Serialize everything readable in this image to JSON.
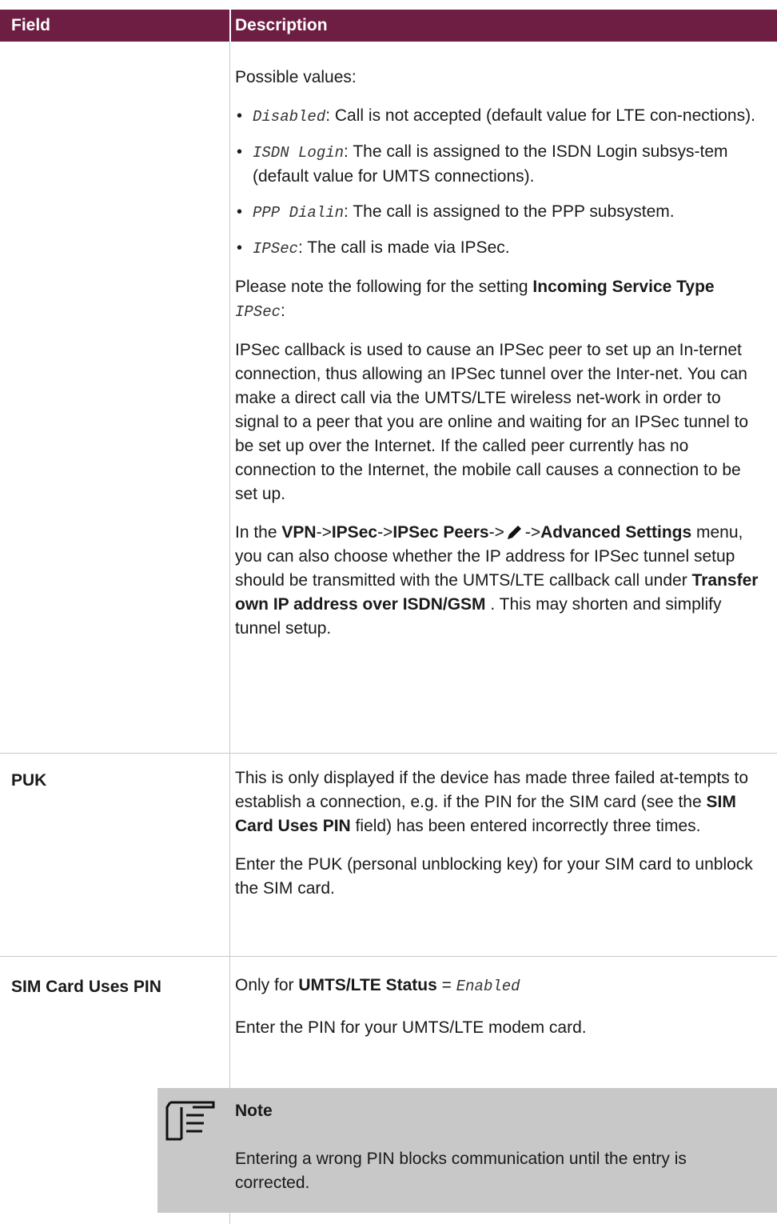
{
  "header": {
    "field": "Field",
    "description": "Description"
  },
  "row1": {
    "possible_values": "Possible values:",
    "items": [
      {
        "code": "Disabled",
        "text": ": Call is not accepted (default value for LTE con-nections)."
      },
      {
        "code": "ISDN Login",
        "text": ": The call is assigned to the ISDN Login subsys-tem (default value for UMTS connections)."
      },
      {
        "code": "PPP Dialin",
        "text": ": The call is assigned to the PPP subsystem."
      },
      {
        "code": "IPSec",
        "text": ": The call is made via IPSec."
      }
    ],
    "note_pre": "Please note the following for the setting ",
    "note_bold": "Incoming Service Type",
    "note_code": "IPSec",
    "note_post": ":",
    "callback_para": "IPSec callback is used to cause an IPSec peer to set up an In-ternet connection, thus allowing an IPSec tunnel over the Inter-net. You can make a direct call via the UMTS/LTE wireless net-work in order to signal to a peer that you are online and waiting for an IPSec tunnel to be set up over the Internet. If the called peer currently has no connection to the Internet, the mobile call causes a connection to be set up.",
    "menu_pre": "In the ",
    "menu_vpn": "VPN",
    "menu_sep1": "->",
    "menu_ipsec": "IPSec",
    "menu_sep2": "->",
    "menu_peers": "IPSec Peers",
    "menu_sep3": "->",
    "menu_sep4": "->",
    "menu_adv": "Advanced Settings",
    "menu_mid": " menu, you can also choose whether the IP address for IPSec tunnel setup should be transmitted with the UMTS/LTE callback call under ",
    "menu_transfer": "Transfer own IP address over ISDN/GSM",
    "menu_end": " . This may shorten and simplify tunnel setup."
  },
  "row_puk": {
    "label": "PUK",
    "p1_pre": "This is only displayed if the device has made three failed at-tempts to establish a connection, e.g. if the PIN for the SIM card (see the ",
    "p1_bold": "SIM Card Uses PIN",
    "p1_post": " field) has been entered incorrectly three times.",
    "p2": "Enter the PUK (personal unblocking key) for your SIM card to unblock the SIM card."
  },
  "row_pin": {
    "label": "SIM Card Uses PIN",
    "only_pre": "Only for ",
    "only_bold": "UMTS/LTE Status",
    "only_eq": " = ",
    "only_code": "Enabled",
    "p2": "Enter the PIN for your UMTS/LTE modem card."
  },
  "note": {
    "title": "Note",
    "text": "Entering a wrong PIN blocks communication until the entry is corrected."
  },
  "colors": {
    "header_bg": "#6e1d43",
    "note_bg": "#c8c8c8",
    "rule": "#c8c8c8"
  }
}
